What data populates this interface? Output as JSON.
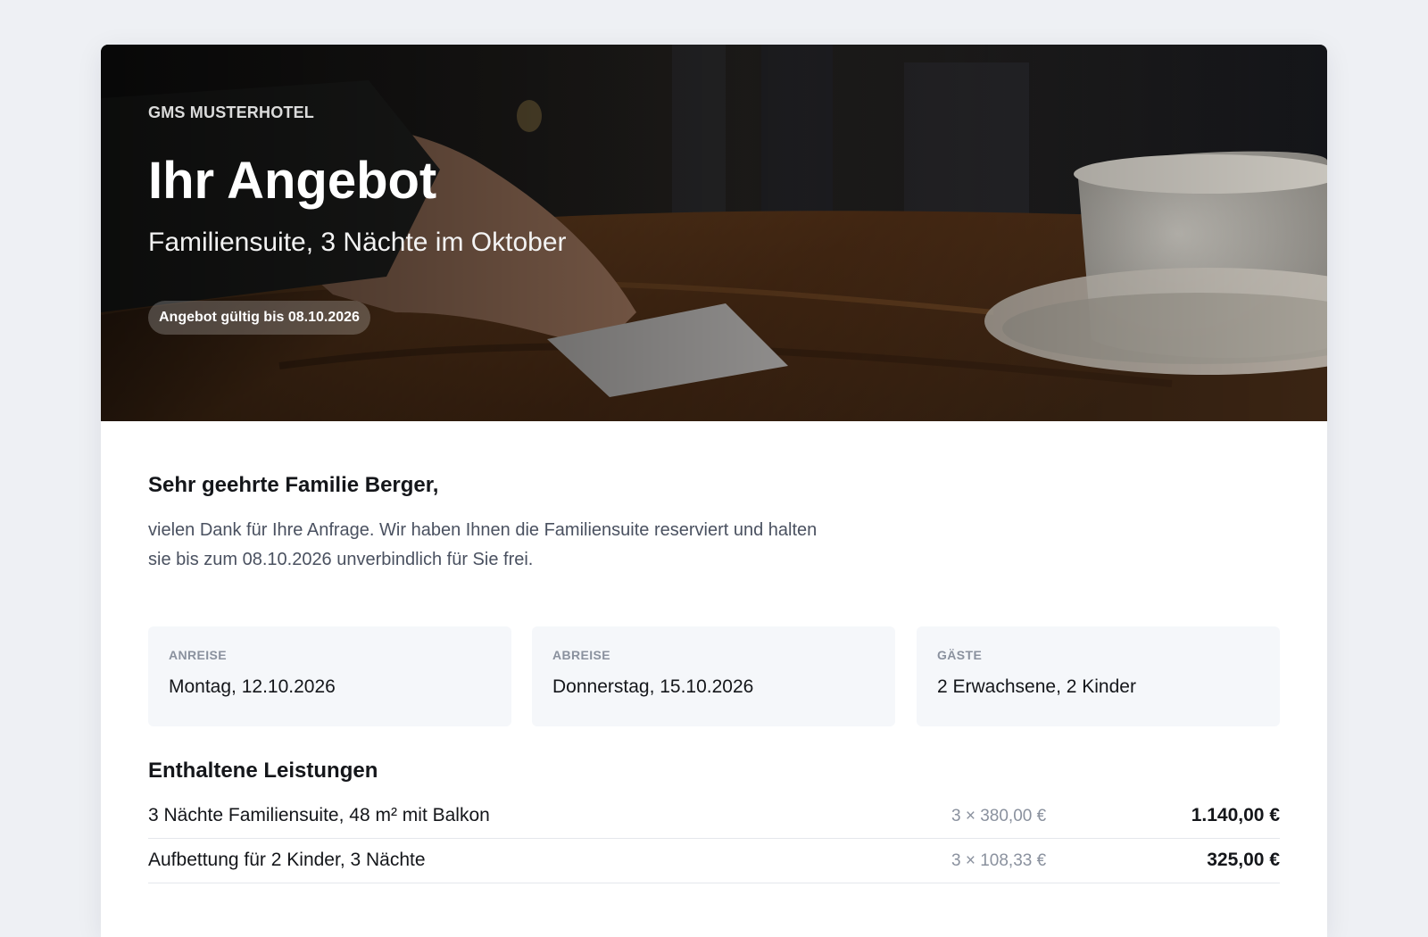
{
  "hero": {
    "hotel_name": "GMS MUSTERHOTEL",
    "title": "Ihr Angebot",
    "subtitle": "Familiensuite, 3 Nächte im Oktober",
    "validity_badge": "Angebot gültig bis 08.10.2026"
  },
  "letter": {
    "greeting": "Sehr geehrte Familie Berger,",
    "intro": "vielen Dank für Ihre Anfrage. Wir haben Ihnen die Familiensuite reserviert und halten sie bis zum 08.10.2026 unverbindlich für Sie frei."
  },
  "stay": [
    {
      "label": "ANREISE",
      "value": "Montag, 12.10.2026"
    },
    {
      "label": "ABREISE",
      "value": "Donnerstag, 15.10.2026"
    },
    {
      "label": "GÄSTE",
      "value": "2 Erwachsene, 2 Kinder"
    }
  ],
  "services": {
    "title": "Enthaltene Leistungen",
    "items": [
      {
        "description": "3 Nächte Familiensuite, 48 m² mit Balkon",
        "calc": "3 × 380,00 €",
        "total": "1.140,00 €"
      },
      {
        "description": "Aufbettung für 2 Kinder, 3 Nächte",
        "calc": "3 × 108,33 €",
        "total": "325,00 €"
      }
    ]
  },
  "colors": {
    "page_background": "#eef0f4",
    "card_background": "#ffffff",
    "info_card_background": "#f5f7fa",
    "muted_text": "#8a919e",
    "body_text": "#4a5160"
  }
}
